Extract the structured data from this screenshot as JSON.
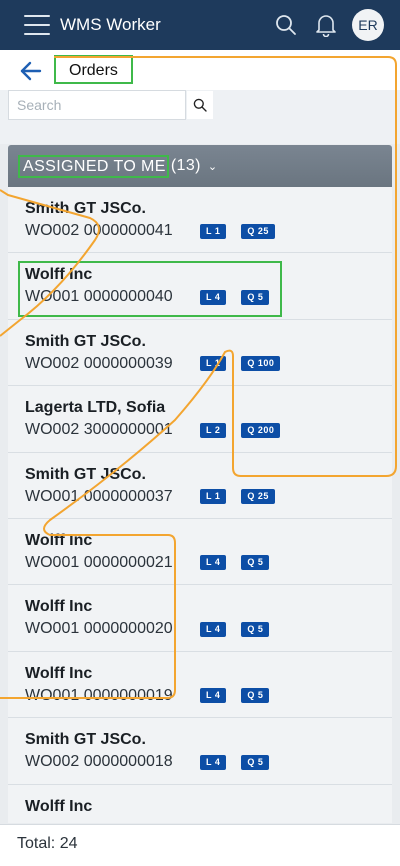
{
  "app": {
    "title": "WMS Worker",
    "avatar_initials": "ER"
  },
  "nav": {
    "title": "Orders"
  },
  "search": {
    "placeholder": "Search",
    "value": ""
  },
  "group": {
    "label": "ASSIGNED TO ME",
    "count": "(13)",
    "chevron": "⌄"
  },
  "orders": [
    {
      "company": "Smith GT JSCo.",
      "order": "WO002 0000000041",
      "location": "L 1",
      "quantity": "Q 25"
    },
    {
      "company": "Wolff Inc",
      "order": "WO001 0000000040",
      "location": "L 4",
      "quantity": "Q 5"
    },
    {
      "company": "Smith GT JSCo.",
      "order": "WO002 0000000039",
      "location": "L 1",
      "quantity": "Q 100"
    },
    {
      "company": "Lagerta LTD, Sofia",
      "order": "WO002 3000000001",
      "location": "L 2",
      "quantity": "Q 200"
    },
    {
      "company": "Smith GT JSCo.",
      "order": "WO001 0000000037",
      "location": "L 1",
      "quantity": "Q 25"
    },
    {
      "company": "Wolff Inc",
      "order": "WO001 0000000021",
      "location": "L 4",
      "quantity": "Q 5"
    },
    {
      "company": "Wolff Inc",
      "order": "WO001 0000000020",
      "location": "L 4",
      "quantity": "Q 5"
    },
    {
      "company": "Wolff Inc",
      "order": "WO001 0000000019",
      "location": "L 4",
      "quantity": "Q 5"
    },
    {
      "company": "Smith GT JSCo.",
      "order": "WO002 0000000018",
      "location": "L 4",
      "quantity": "Q 5"
    },
    {
      "company": "Wolff Inc",
      "order": "",
      "location": "",
      "quantity": ""
    }
  ],
  "footer": {
    "total": "Total: 24"
  },
  "colors": {
    "topbar": "#1e3a5c",
    "badge": "#0d4ea6",
    "highlight": "#3fb94a",
    "trace": "#f3a530"
  },
  "icons": {
    "menu": "hamburger-icon",
    "search": "search-icon",
    "notifications": "bell-icon",
    "back": "arrow-left-icon",
    "search_button": "magnifier-icon"
  }
}
